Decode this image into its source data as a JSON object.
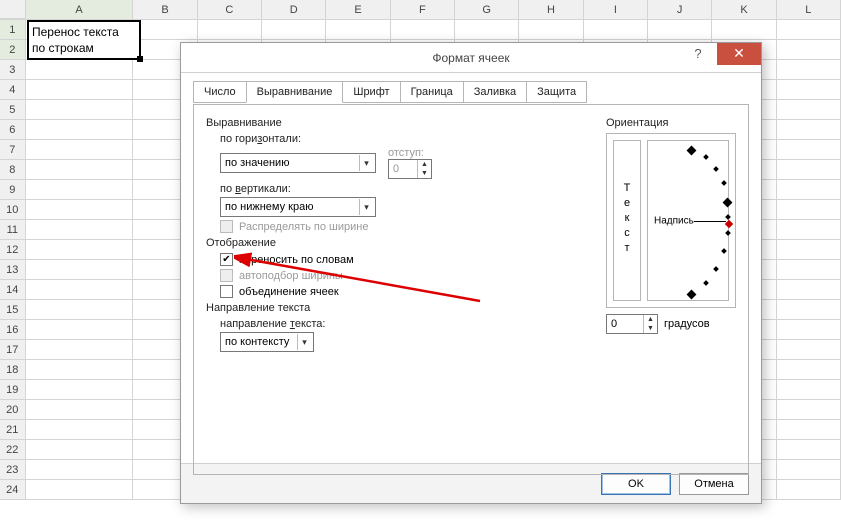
{
  "columns": [
    "A",
    "B",
    "C",
    "D",
    "E",
    "F",
    "G",
    "H",
    "I",
    "J",
    "K",
    "L"
  ],
  "rows": [
    "1",
    "2",
    "3",
    "4",
    "5",
    "6",
    "7",
    "8",
    "9",
    "10",
    "11",
    "12",
    "13",
    "14",
    "15",
    "16",
    "17",
    "18",
    "19",
    "20",
    "21",
    "22",
    "23",
    "24"
  ],
  "selected_col": "A",
  "selected_rows": [
    "1",
    "2"
  ],
  "cell_text_line1": "Перенос текста",
  "cell_text_line2": "по строкам",
  "dialog": {
    "title": "Формат ячеек",
    "help": "?",
    "close": "✕",
    "tabs": [
      "Число",
      "Выравнивание",
      "Шрифт",
      "Граница",
      "Заливка",
      "Защита"
    ],
    "active_tab": "Выравнивание",
    "alignment_section": "Выравнивание",
    "horiz_label": "по горизонтали:",
    "horiz_value": "по значению",
    "indent_label": "отступ:",
    "indent_value": "0",
    "vert_label": "по вертикали:",
    "vert_value": "по нижнему краю",
    "justify_distrib": "Распределять по ширине",
    "display_section": "Отображение",
    "wrap_text": "переносить по словам",
    "shrink_fit": "автоподбор ширины",
    "merge_cells": "объединение ячеек",
    "text_dir_section": "Направление текста",
    "text_dir_label": "направление текста:",
    "text_dir_value": "по контексту",
    "orientation_section": "Ориентация",
    "orient_vert_text": "Т\nе\nк\nс\nт",
    "orient_label": "Надпись",
    "degrees_value": "0",
    "degrees_label": "градусов",
    "ok": "OK",
    "cancel": "Отмена"
  }
}
